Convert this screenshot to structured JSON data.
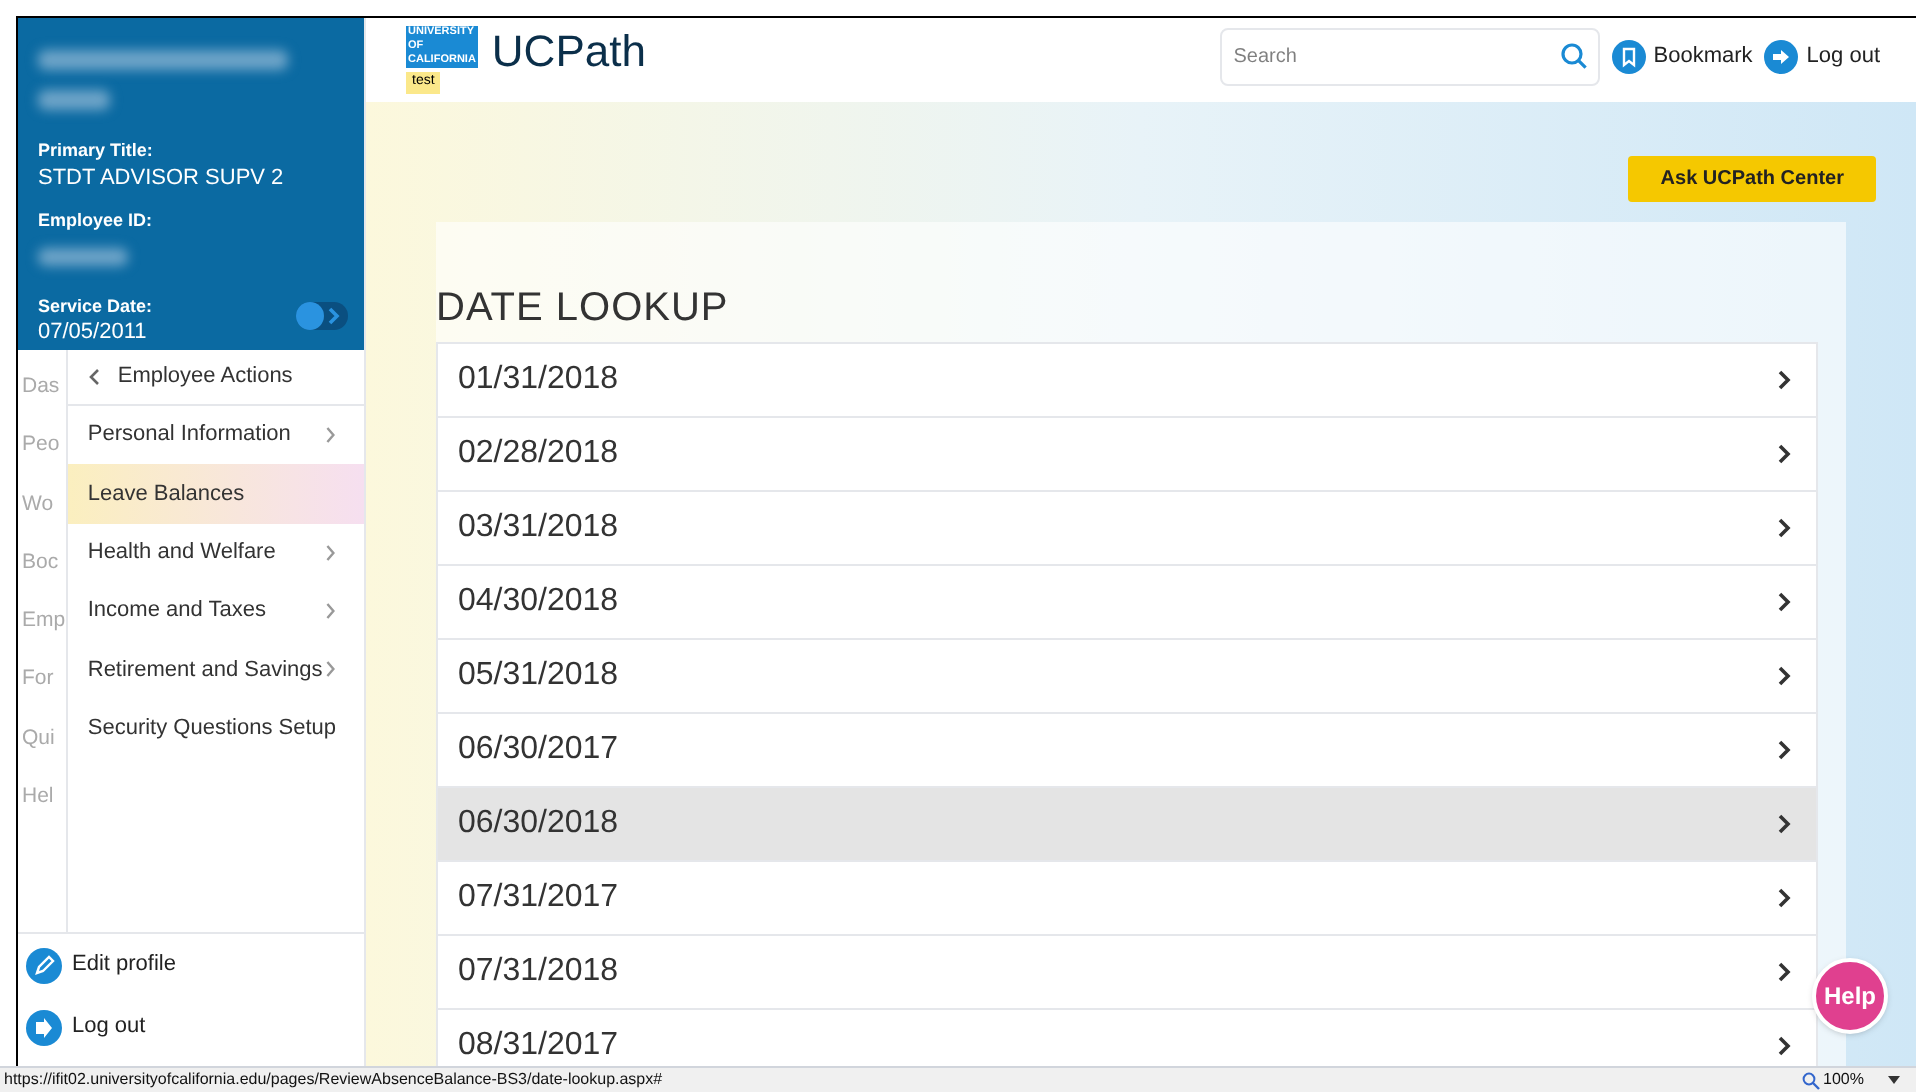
{
  "profile": {
    "primary_title_label": "Primary Title:",
    "primary_title": "STDT ADVISOR SUPV 2",
    "employee_id_label": "Employee ID:",
    "service_date_label": "Service Date:",
    "service_date": "07/05/2011"
  },
  "main_nav": [
    "Das",
    "Peo",
    "Wo",
    "Boc",
    "Emp",
    "For",
    "Qui",
    "Hel"
  ],
  "submenu": {
    "back_label": "Employee Actions",
    "items": [
      {
        "label": "Personal Information",
        "has_children": true,
        "selected": false
      },
      {
        "label": "Leave Balances",
        "has_children": false,
        "selected": true
      },
      {
        "label": "Health and Welfare",
        "has_children": true,
        "selected": false
      },
      {
        "label": "Income and Taxes",
        "has_children": true,
        "selected": false
      },
      {
        "label": "Retirement and Savings",
        "has_children": true,
        "selected": false
      },
      {
        "label": "Security Questions Setup",
        "has_children": false,
        "selected": false
      }
    ]
  },
  "sidebar_footer": [
    "Edit profile",
    "Log out"
  ],
  "header": {
    "logo_lines": [
      "UNIVERSITY",
      "OF",
      "CALIFORNIA"
    ],
    "env_badge": "test",
    "app_name": "UCPath",
    "search_placeholder": "Search",
    "bookmark": "Bookmark",
    "logout": "Log out"
  },
  "ask_button": "Ask UCPath Center",
  "page_title": "DATE LOOKUP",
  "dates": [
    {
      "label": "01/31/2018",
      "selected": false
    },
    {
      "label": "02/28/2018",
      "selected": false
    },
    {
      "label": "03/31/2018",
      "selected": false
    },
    {
      "label": "04/30/2018",
      "selected": false
    },
    {
      "label": "05/31/2018",
      "selected": false
    },
    {
      "label": "06/30/2017",
      "selected": false
    },
    {
      "label": "06/30/2018",
      "selected": true
    },
    {
      "label": "07/31/2017",
      "selected": false
    },
    {
      "label": "07/31/2018",
      "selected": false
    },
    {
      "label": "08/31/2017",
      "selected": false
    }
  ],
  "help_button": "Help",
  "status_bar": {
    "url": "https://ifit02.universityofcalifornia.edu/pages/ReviewAbsenceBalance-BS3/date-lookup.aspx#",
    "zoom": "100%"
  }
}
